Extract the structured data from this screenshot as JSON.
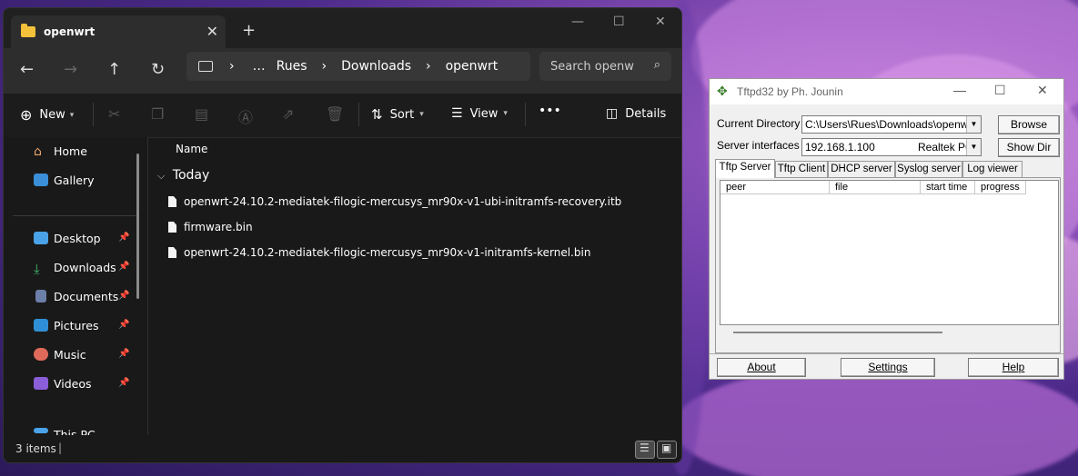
{
  "explorer": {
    "tab_title": "openwrt",
    "new_tab": "+",
    "nav": {
      "back": "←",
      "forward": "→",
      "up": "↑",
      "refresh": "↻"
    },
    "breadcrumb": [
      "…",
      "Rues",
      "Downloads",
      "openwrt"
    ],
    "breadcrumb_sep": "›",
    "search_placeholder": "Search openw",
    "toolbar": {
      "new": "New",
      "sort": "Sort",
      "view": "View",
      "more": "•••",
      "details": "Details"
    },
    "sidebar": {
      "items": [
        {
          "label": "Home",
          "icon": "home-icon"
        },
        {
          "label": "Gallery",
          "icon": "gallery-icon"
        },
        {
          "label": "Desktop",
          "icon": "desktop-icon",
          "pinned": true
        },
        {
          "label": "Downloads",
          "icon": "downloads-icon",
          "pinned": true
        },
        {
          "label": "Documents",
          "icon": "documents-icon",
          "pinned": true
        },
        {
          "label": "Pictures",
          "icon": "pictures-icon",
          "pinned": true
        },
        {
          "label": "Music",
          "icon": "music-icon",
          "pinned": true
        },
        {
          "label": "Videos",
          "icon": "videos-icon",
          "pinned": true
        },
        {
          "label": "This PC",
          "icon": "this-pc-icon"
        }
      ]
    },
    "column_header": "Name",
    "group": "Today",
    "files": [
      "openwrt-24.10.2-mediatek-filogic-mercusys_mr90x-v1-ubi-initramfs-recovery.itb",
      "firmware.bin",
      "openwrt-24.10.2-mediatek-filogic-mercusys_mr90x-v1-initramfs-kernel.bin"
    ],
    "status": "3 items"
  },
  "tftp": {
    "title": "Tftpd32 by Ph. Jounin",
    "current_directory_label": "Current Directory",
    "current_directory": "C:\\Users\\Rues\\Downloads\\openwrt",
    "server_interfaces_label": "Server interfaces",
    "server_ip": "192.168.1.100",
    "server_adapter": "Realtek PC",
    "browse": "Browse",
    "show_dir": "Show Dir",
    "tabs": [
      "Tftp Server",
      "Tftp Client",
      "DHCP server",
      "Syslog server",
      "Log viewer"
    ],
    "columns": [
      "peer",
      "file",
      "start time",
      "progress"
    ],
    "about": "About",
    "settings": "Settings",
    "help": "Help"
  }
}
